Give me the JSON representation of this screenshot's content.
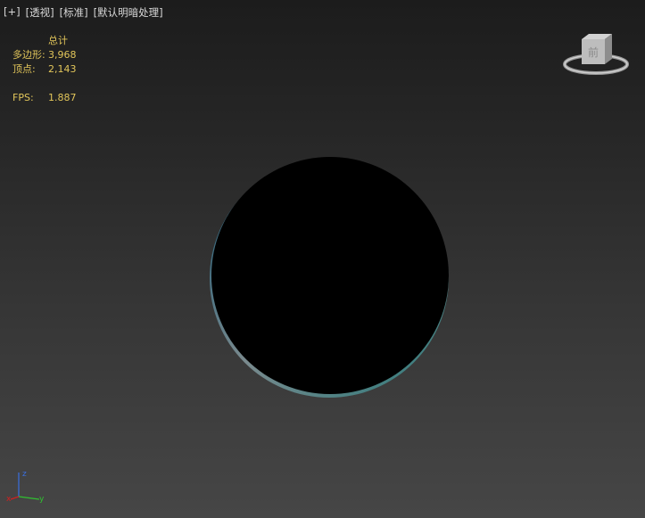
{
  "viewport": {
    "labels": {
      "plus": "[+]",
      "view": "[透视]",
      "shading": "[标准]",
      "lighting": "[默认明暗处理]"
    }
  },
  "stats": {
    "header": "总计",
    "polygons_label": "多边形:",
    "polygons_value": "3,968",
    "vertices_label": "顶点:",
    "vertices_value": "2,143",
    "fps_label": "FPS:",
    "fps_value": "1.887"
  },
  "viewcube": {
    "face_label": "前",
    "icon": "viewcube-icon"
  },
  "tripod": {
    "x": "x",
    "y": "y",
    "z": "z"
  },
  "colors": {
    "stats_text": "#e1c55a",
    "label_text": "#d8d8d8",
    "axis_x": "#d02020",
    "axis_y": "#30c030",
    "axis_z": "#3a6fe0"
  }
}
